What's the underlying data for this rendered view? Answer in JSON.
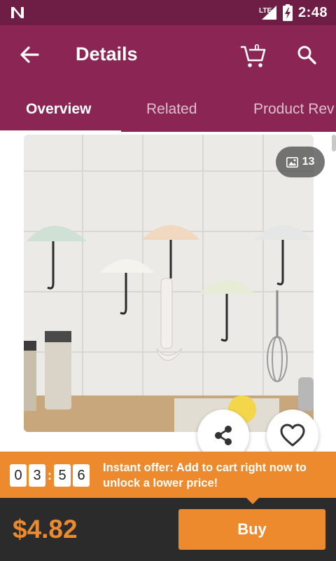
{
  "status_bar": {
    "network": "LTE",
    "time": "2:48"
  },
  "app_bar": {
    "title": "Details",
    "cart_count": "0"
  },
  "tabs": [
    {
      "label": "Overview",
      "active": true
    },
    {
      "label": "Related",
      "active": false
    },
    {
      "label": "Product Rev",
      "active": false
    }
  ],
  "product": {
    "image_count": "13",
    "image_icon": "image-icon"
  },
  "offer": {
    "timer_digits": [
      "0",
      "3",
      "5",
      "6"
    ],
    "separator": ":",
    "text": "Instant offer: Add to cart right now to unlock a lower price!"
  },
  "purchase": {
    "price": "$4.82",
    "buy_label": "Buy"
  },
  "colors": {
    "app_bar": "#8b2554",
    "status_bar": "#6e1d44",
    "accent": "#ee8a2e",
    "bottom_bar": "#2b2b2b"
  }
}
